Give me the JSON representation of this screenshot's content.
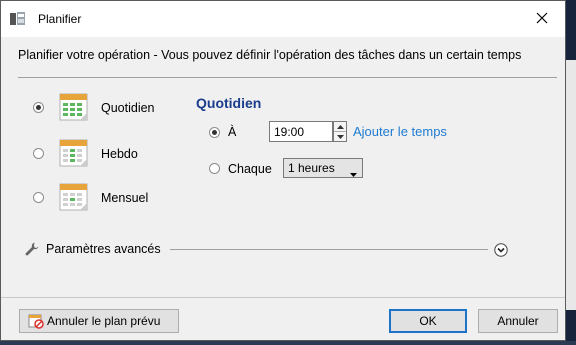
{
  "window": {
    "title": "Planifier",
    "description": "Planifier votre opération - Vous pouvez définir l'opération des tâches dans un certain temps"
  },
  "schedule_types": [
    {
      "label": "Quotidien",
      "selected": true,
      "icon": "calendar-daily-icon",
      "accent": "#4caf50"
    },
    {
      "label": "Hebdo",
      "selected": false,
      "icon": "calendar-weekly-icon",
      "accent": "#4caf50"
    },
    {
      "label": "Mensuel",
      "selected": false,
      "icon": "calendar-monthly-icon",
      "accent": "#4caf50"
    }
  ],
  "detail": {
    "title": "Quotidien",
    "at_label": "À",
    "at_selected": true,
    "time_value": "19:00",
    "add_time_link": "Ajouter le temps",
    "every_label": "Chaque",
    "every_selected": false,
    "interval_value": "1 heures"
  },
  "advanced": {
    "label": "Paramètres avancés",
    "icon": "wrench-icon",
    "toggle_icon": "chevron-down-icon"
  },
  "buttons": {
    "cancel_plan": "Annuler le plan prévu",
    "ok": "OK",
    "cancel": "Annuler"
  },
  "colors": {
    "section_title": "#1a3c8c",
    "link": "#1e7bd1",
    "primary_border": "#1e73c8"
  }
}
